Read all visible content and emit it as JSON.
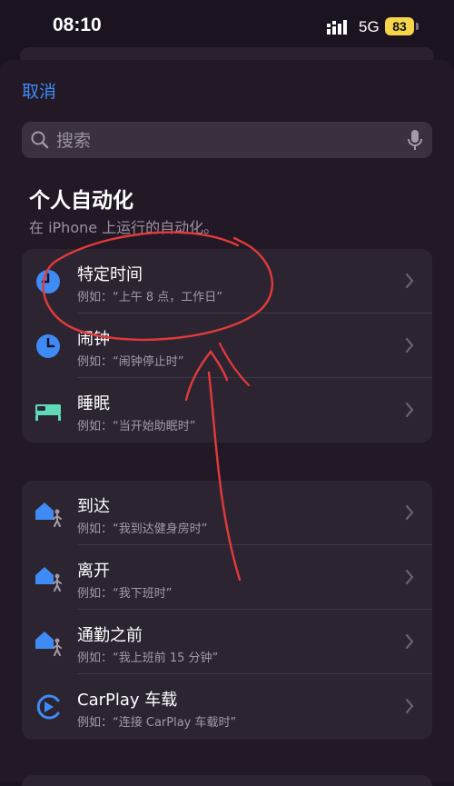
{
  "status": {
    "time": "08:10",
    "network": "5G",
    "battery": "83"
  },
  "nav": {
    "cancel": "取消"
  },
  "search": {
    "placeholder": "搜索"
  },
  "section": {
    "title": "个人自动化",
    "subtitle": "在 iPhone 上运行的自动化。"
  },
  "group1": [
    {
      "title": "特定时间",
      "subtitle": "例如：“上午 8 点，工作日”",
      "icon": "clock-icon"
    },
    {
      "title": "闹钟",
      "subtitle": "例如：“闹钟停止时”",
      "icon": "alarm-clock-icon"
    },
    {
      "title": "睡眠",
      "subtitle": "例如：“当开始助眠时”",
      "icon": "bed-icon"
    }
  ],
  "group2": [
    {
      "title": "到达",
      "subtitle": "例如：“我到达健身房时”",
      "icon": "home-person-icon"
    },
    {
      "title": "离开",
      "subtitle": "例如：“我下班时”",
      "icon": "home-person-icon"
    },
    {
      "title": "通勤之前",
      "subtitle": "例如：“我上班前 15 分钟”",
      "icon": "home-person-icon"
    },
    {
      "title": "CarPlay 车载",
      "subtitle": "例如：“连接 CarPlay 车载时”",
      "icon": "carplay-icon"
    }
  ],
  "colors": {
    "accent": "#3f8bf5",
    "annotation": "#e23a3a",
    "bed": "#5fd9b8"
  }
}
